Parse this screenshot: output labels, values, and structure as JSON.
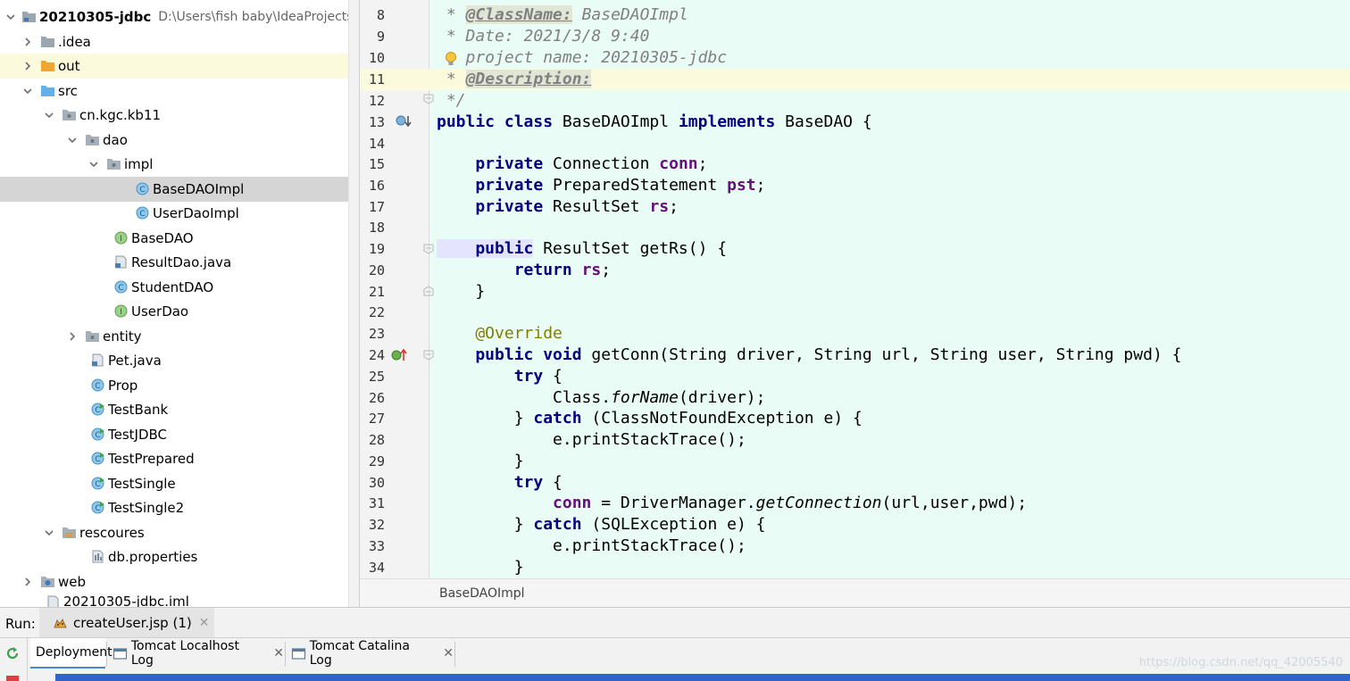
{
  "project_tree": {
    "rows": [
      {
        "label": "20210305-jdbc",
        "path": "D:\\Users\\fish baby\\IdeaProjects",
        "icon": "project-folder-icon",
        "arrow": "down"
      },
      {
        "label": ".idea",
        "icon": "folder-icon",
        "arrow": "right"
      },
      {
        "label": "out",
        "icon": "orange-folder-icon",
        "arrow": "right"
      },
      {
        "label": "src",
        "icon": "source-folder-icon",
        "arrow": "down"
      },
      {
        "label": "cn.kgc.kb11",
        "icon": "package-icon",
        "arrow": "down"
      },
      {
        "label": "dao",
        "icon": "package-icon",
        "arrow": "down"
      },
      {
        "label": "impl",
        "icon": "package-icon",
        "arrow": "down"
      },
      {
        "label": "BaseDAOImpl",
        "icon": "class-icon",
        "arrow": "none"
      },
      {
        "label": "UserDaoImpl",
        "icon": "class-icon",
        "arrow": "none"
      },
      {
        "label": "BaseDAO",
        "icon": "interface-icon",
        "arrow": "none"
      },
      {
        "label": "ResultDao.java",
        "icon": "java-file-icon",
        "arrow": "none"
      },
      {
        "label": "StudentDAO",
        "icon": "class-icon",
        "arrow": "none"
      },
      {
        "label": "UserDao",
        "icon": "interface-icon",
        "arrow": "none"
      },
      {
        "label": "entity",
        "icon": "package-icon",
        "arrow": "right"
      },
      {
        "label": "Pet.java",
        "icon": "java-file-icon",
        "arrow": "none"
      },
      {
        "label": "Prop",
        "icon": "class-icon",
        "arrow": "none"
      },
      {
        "label": "TestBank",
        "icon": "runnable-class-icon",
        "arrow": "none"
      },
      {
        "label": "TestJDBC",
        "icon": "runnable-class-icon",
        "arrow": "none"
      },
      {
        "label": "TestPrepared",
        "icon": "runnable-class-icon",
        "arrow": "none"
      },
      {
        "label": "TestSingle",
        "icon": "runnable-class-icon",
        "arrow": "none"
      },
      {
        "label": "TestSingle2",
        "icon": "runnable-class-icon",
        "arrow": "none"
      },
      {
        "label": "rescoures",
        "icon": "resources-folder-icon",
        "arrow": "down"
      },
      {
        "label": "db.properties",
        "icon": "properties-file-icon",
        "arrow": "none"
      },
      {
        "label": "web",
        "icon": "web-folder-icon",
        "arrow": "right"
      },
      {
        "label": "20210305-jdbc.iml",
        "icon": "iml-file-icon",
        "arrow": "none"
      }
    ]
  },
  "editor": {
    "line_numbers": [
      "8",
      "9",
      "10",
      "11",
      "12",
      "13",
      "14",
      "15",
      "16",
      "17",
      "18",
      "19",
      "20",
      "21",
      "22",
      "23",
      "24",
      "25",
      "26",
      "27",
      "28",
      "29",
      "30",
      "31",
      "32",
      "33",
      "34"
    ],
    "lines": {
      "l8_star": " * ",
      "l8_tag": "@ClassName:",
      "l8_rest": " BaseDAOImpl",
      "l9": " * Date: 2021/3/8 9:40",
      "l10": "   project name: 20210305-jdbc",
      "l11_star": " * ",
      "l11_tag": "@Description:",
      "l12": " */",
      "l13_kw1": "public class",
      "l13_name": " BaseDAOImpl ",
      "l13_kw2": "implements",
      "l13_rest": " BaseDAO {",
      "l15_kw": "    private",
      "l15_type": " Connection ",
      "l15_fld": "conn",
      "l15_end": ";",
      "l16_kw": "    private",
      "l16_type": " PreparedStatement ",
      "l16_fld": "pst",
      "l16_end": ";",
      "l17_kw": "    private",
      "l17_type": " ResultSet ",
      "l17_fld": "rs",
      "l17_end": ";",
      "l19_kw": "    public",
      "l19_rest": " ResultSet getRs() {",
      "l20_kw": "        return",
      "l20_sp": " ",
      "l20_fld": "rs",
      "l20_end": ";",
      "l21": "    }",
      "l23": "    @Override",
      "l24_kw": "    public void",
      "l24_rest": " getConn(String driver, String url, String user, String pwd) {",
      "l25_kw": "        try",
      "l25_rest": " {",
      "l26_a": "            Class.",
      "l26_m": "forName",
      "l26_b": "(driver);",
      "l27_a": "        } ",
      "l27_kw": "catch",
      "l27_b": " (ClassNotFoundException e) {",
      "l28": "            e.printStackTrace();",
      "l29": "        }",
      "l30_kw": "        try",
      "l30_rest": " {",
      "l31_a": "            ",
      "l31_fld": "conn",
      "l31_b": " = DriverManager.",
      "l31_m": "getConnection",
      "l31_c": "(url,user,pwd);",
      "l32_a": "        } ",
      "l32_kw": "catch",
      "l32_b": " (SQLException e) {",
      "l33": "            e.printStackTrace();",
      "l34": "        }"
    }
  },
  "breadcrumb": "BaseDAOImpl",
  "run_window": {
    "label": "Run:",
    "tab_label": "createUser.jsp (1)",
    "tab_close": "✕",
    "sub_tabs": [
      {
        "label": "Deployment"
      },
      {
        "label": "Tomcat Localhost Log",
        "close": "✕"
      },
      {
        "label": "Tomcat Catalina Log",
        "close": "✕"
      }
    ],
    "watermark": "https://blog.csdn.net/qq_42005540"
  },
  "colors": {
    "editor_bg": "#eafcf6",
    "keyword": "#000080",
    "field": "#660e7a",
    "comment": "#808080",
    "annotation": "#808000",
    "selection": "#d5d5d5",
    "highlight_row": "#fcfadc"
  }
}
